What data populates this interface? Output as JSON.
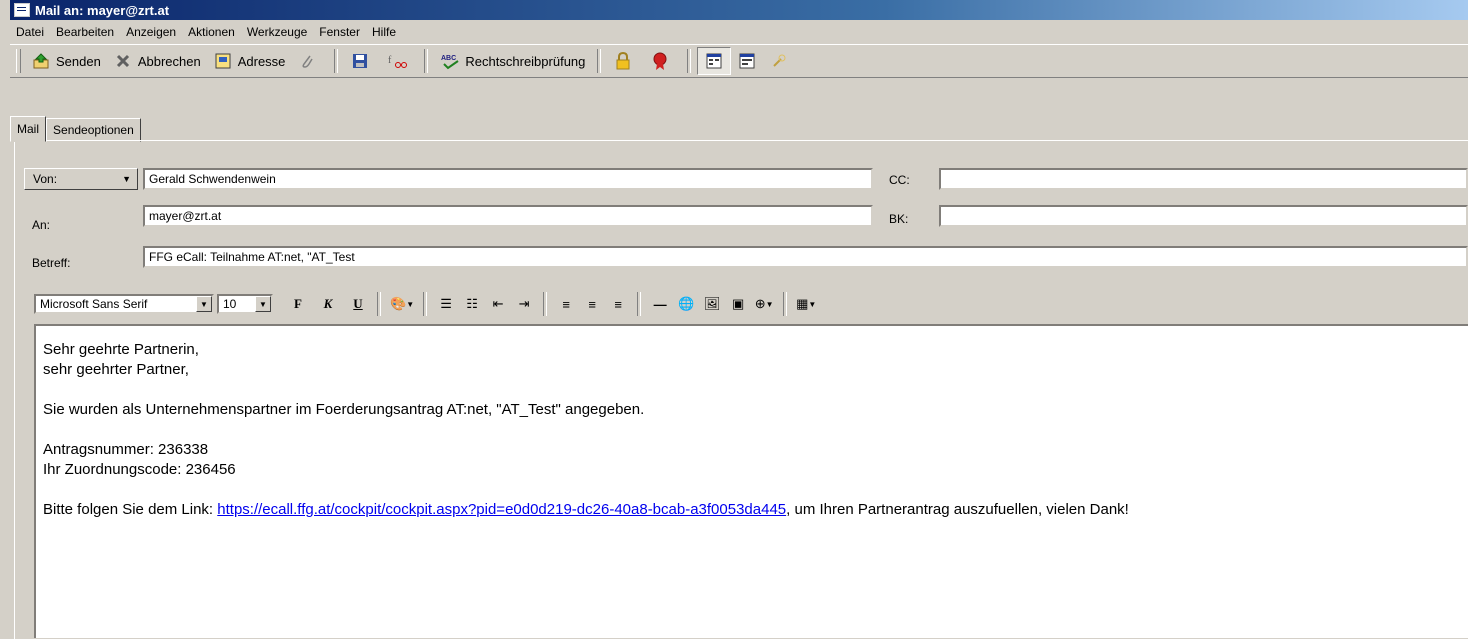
{
  "window": {
    "title": "Mail an: mayer@zrt.at"
  },
  "menu": [
    "Datei",
    "Bearbeiten",
    "Anzeigen",
    "Aktionen",
    "Werkzeuge",
    "Fenster",
    "Hilfe"
  ],
  "toolbar": {
    "send": "Senden",
    "cancel": "Abbrechen",
    "address": "Adresse",
    "spellcheck": "Rechtschreibprüfung"
  },
  "tabs": [
    "Mail",
    "Sendeoptionen"
  ],
  "header": {
    "from_label": "Von:",
    "from_value": "Gerald Schwendenwein",
    "to_label": "An:",
    "to_value": "mayer@zrt.at",
    "subject_label": "Betreff:",
    "subject_value": "FFG eCall: Teilnahme AT:net, \"AT_Test",
    "cc_label": "CC:",
    "cc_value": "",
    "bcc_label": "BK:",
    "bcc_value": ""
  },
  "format": {
    "font": "Microsoft Sans Serif",
    "size": "10",
    "bold": "F",
    "italic": "K",
    "underline": "U"
  },
  "body": {
    "greeting1": "Sehr geehrte Partnerin,",
    "greeting2": "sehr geehrter Partner,",
    "line1": "Sie wurden als Unternehmenspartner im Foerderungsantrag AT:net, \"AT_Test\" angegeben.",
    "line2": "Antragsnummer: 236338",
    "line3": "Ihr Zuordnungscode: 236456",
    "link_prefix": "Bitte folgen Sie dem Link: ",
    "link": "https://ecall.ffg.at/cockpit/cockpit.aspx?pid=e0d0d219-dc26-40a8-bcab-a3f0053da445",
    "link_suffix": ", um Ihren Partnerantrag auszufuellen, vielen Dank!"
  }
}
